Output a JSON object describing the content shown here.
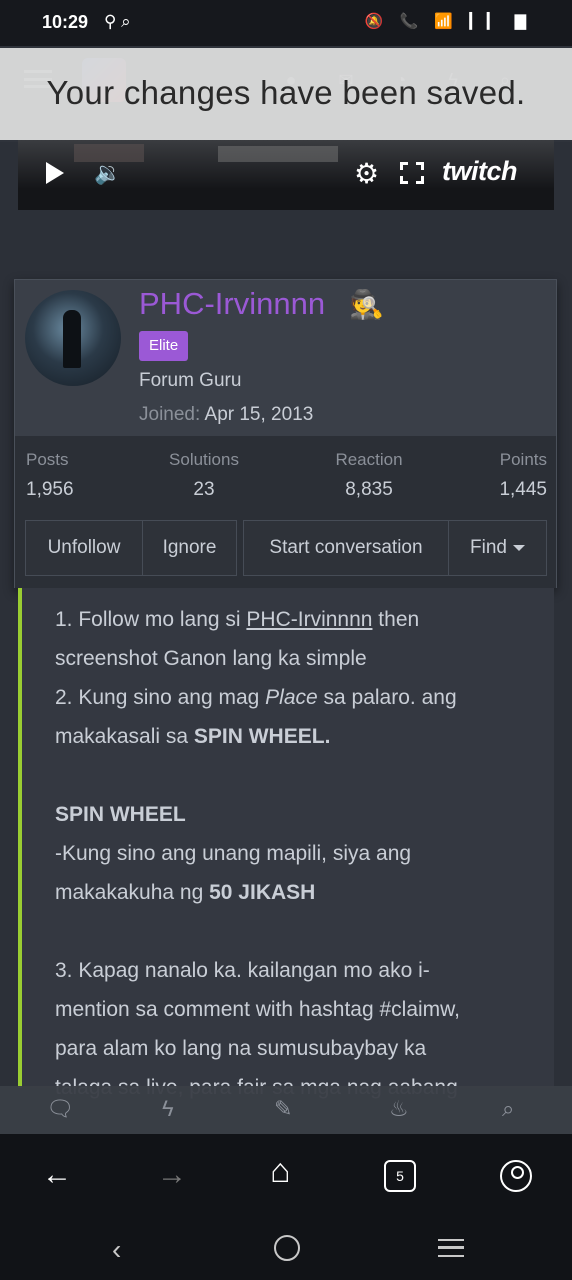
{
  "status_bar": {
    "time": "10:29",
    "left_icons": "⚲ ⌕",
    "right_icons": "🔕 📞 📶 ▎▎ ▇"
  },
  "toast": {
    "message": "Your changes have been saved."
  },
  "video_player": {
    "play_icon": "play-icon",
    "volume_icon": "🔉",
    "settings_icon": "⚙",
    "brand": "twitch"
  },
  "profile": {
    "username": "PHC-Irvinnnn",
    "username_icon": "🕵",
    "badge": "Elite",
    "title": "Forum Guru",
    "joined_label": "Joined:",
    "joined_date": "Apr 15, 2013",
    "stats": [
      {
        "label": "Posts",
        "value": "1,956"
      },
      {
        "label": "Solutions",
        "value": "23"
      },
      {
        "label": "Reaction",
        "value": "8,835"
      },
      {
        "label": "Points",
        "value": "1,445"
      }
    ],
    "buttons": {
      "unfollow": "Unfollow",
      "ignore": "Ignore",
      "start_conversation": "Start conversation",
      "find": "Find"
    }
  },
  "post": {
    "l1a": "1. Follow mo lang si ",
    "l1link": "PHC-Irvinnnn",
    "l1b": " then",
    "l2": "screenshot Ganon lang ka simple",
    "l3a": "2. Kung sino ang mag ",
    "l3em": "Place",
    "l3b": " sa palaro. ang",
    "l4a": "makakasali sa ",
    "l4b": "SPIN WHEEL.",
    "l5": "SPIN WHEEL",
    "l6": "-Kung sino ang unang mapili, siya ang",
    "l7a": "makakakuha ng ",
    "l7b": "50 JIKASH",
    "l8": "3. Kapag nanalo ka. kailangan mo ako i-",
    "l9": "mention sa comment with hashtag #claimw,",
    "l10": "para alam ko lang na sumusubaybay ka",
    "l11": "talaga sa live, para fair sa mga nag aabang"
  },
  "forum_nav": {
    "icons": [
      "🗨",
      "ϟ",
      "✎",
      "♨",
      "⌕"
    ]
  },
  "browser": {
    "back": "←",
    "forward": "→",
    "home": "⌂",
    "tab_count": "5"
  },
  "system_nav": {
    "back": "‹"
  }
}
